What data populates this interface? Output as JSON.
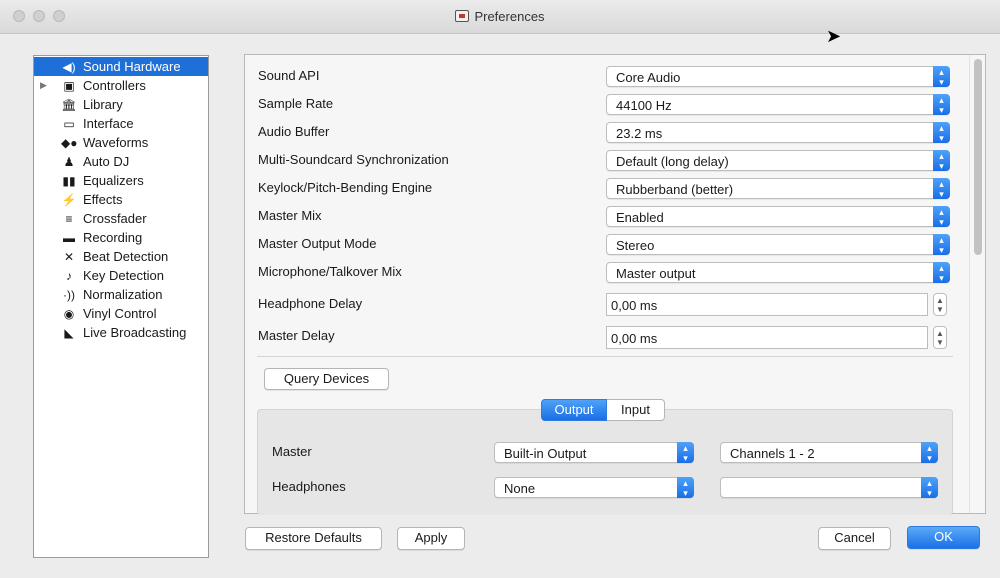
{
  "window": {
    "title": "Preferences"
  },
  "sidebar": {
    "items": [
      {
        "label": "Sound Hardware",
        "icon": "speaker-icon",
        "glyph": "◀)"
      },
      {
        "label": "Controllers",
        "icon": "controller-icon",
        "glyph": "▣"
      },
      {
        "label": "Library",
        "icon": "library-icon",
        "glyph": "🏛"
      },
      {
        "label": "Interface",
        "icon": "monitor-icon",
        "glyph": "▭"
      },
      {
        "label": "Waveforms",
        "icon": "waveform-icon",
        "glyph": "◆●"
      },
      {
        "label": "Auto DJ",
        "icon": "robot-icon",
        "glyph": "♟"
      },
      {
        "label": "Equalizers",
        "icon": "equalizer-icon",
        "glyph": "▮▮"
      },
      {
        "label": "Effects",
        "icon": "effects-icon",
        "glyph": "⚡"
      },
      {
        "label": "Crossfader",
        "icon": "crossfader-icon",
        "glyph": "≡"
      },
      {
        "label": "Recording",
        "icon": "recording-icon",
        "glyph": "▬"
      },
      {
        "label": "Beat Detection",
        "icon": "beat-detection-icon",
        "glyph": "✕"
      },
      {
        "label": "Key Detection",
        "icon": "key-detection-icon",
        "glyph": "♪"
      },
      {
        "label": "Normalization",
        "icon": "normalization-icon",
        "glyph": "·))"
      },
      {
        "label": "Vinyl Control",
        "icon": "vinyl-icon",
        "glyph": "◉"
      },
      {
        "label": "Live Broadcasting",
        "icon": "broadcast-icon",
        "glyph": "◣"
      }
    ]
  },
  "settings": [
    {
      "label": "Sound API",
      "value": "Core Audio"
    },
    {
      "label": "Sample Rate",
      "value": "44100 Hz"
    },
    {
      "label": "Audio Buffer",
      "value": "23.2 ms"
    },
    {
      "label": "Multi-Soundcard Synchronization",
      "value": "Default (long delay)"
    },
    {
      "label": "Keylock/Pitch-Bending Engine",
      "value": "Rubberband (better)"
    },
    {
      "label": "Master Mix",
      "value": "Enabled"
    },
    {
      "label": "Master Output Mode",
      "value": "Stereo"
    },
    {
      "label": "Microphone/Talkover Mix",
      "value": "Master output"
    }
  ],
  "delays": [
    {
      "label": "Headphone Delay",
      "value": "0,00 ms"
    },
    {
      "label": "Master Delay",
      "value": "0,00 ms"
    }
  ],
  "query_devices_label": "Query Devices",
  "tabs": {
    "output": "Output",
    "input": "Input"
  },
  "outputs": [
    {
      "label": "Master",
      "device": "Built-in Output",
      "channels": "Channels 1 - 2"
    },
    {
      "label": "Headphones",
      "device": "None",
      "channels": ""
    }
  ],
  "footer": {
    "restore_defaults": "Restore Defaults",
    "apply": "Apply",
    "cancel": "Cancel",
    "ok": "OK"
  },
  "colors": {
    "accent": "#1e70d8",
    "button_blue": "#1b70e6"
  }
}
